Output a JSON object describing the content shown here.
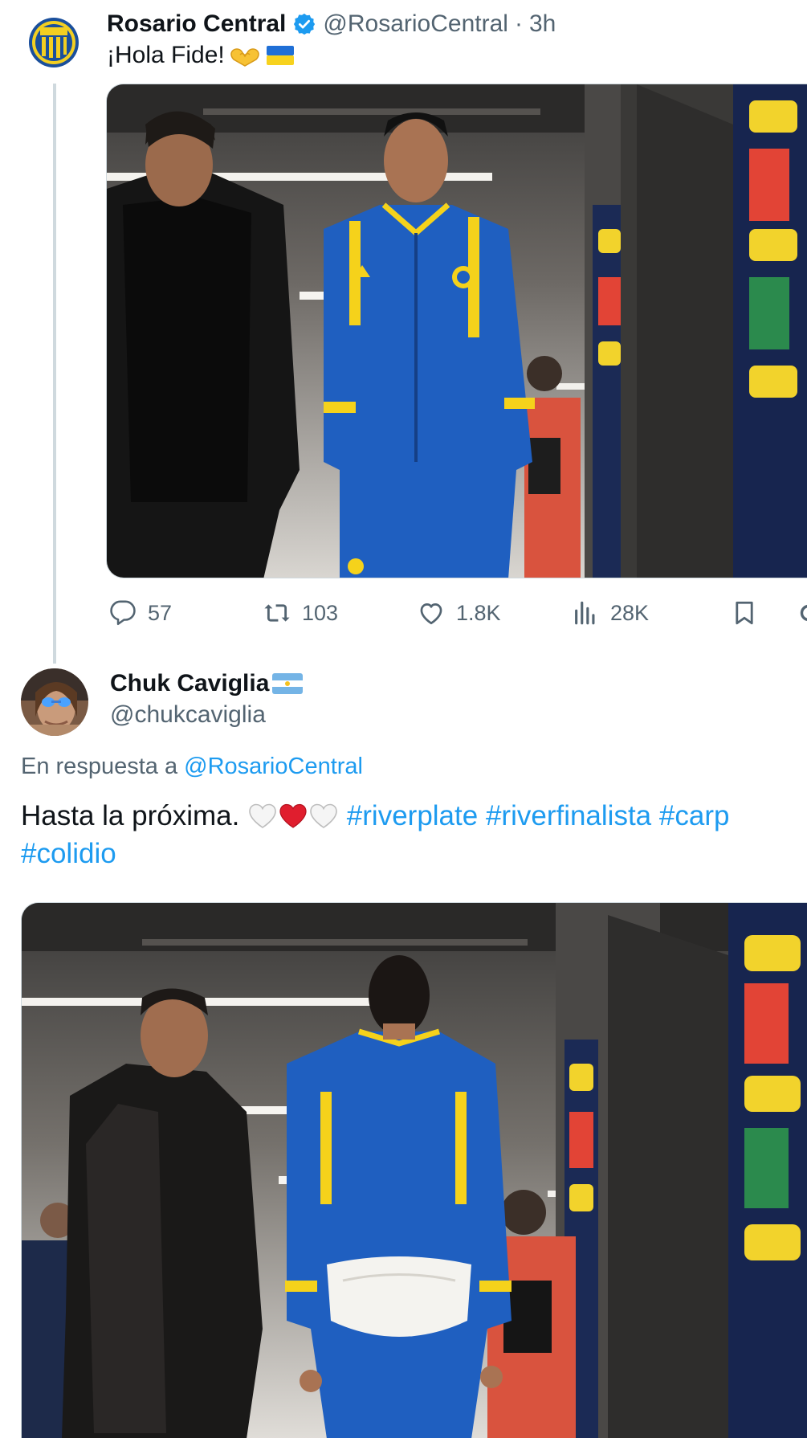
{
  "tweet1": {
    "author_name": "Rosario Central",
    "handle": "@RosarioCentral",
    "separator": "·",
    "time": "3h",
    "text": "¡Hola Fide!",
    "stats": {
      "replies": "57",
      "retweets": "103",
      "likes": "1.8K",
      "views": "28K"
    }
  },
  "tweet2": {
    "author_name": "Chuk Caviglia",
    "handle": "@chukcaviglia",
    "replying_prefix": "En respuesta a",
    "replying_to": "@RosarioCentral",
    "text_start": "Hasta la próxima.",
    "hashtags": [
      "#riverplate",
      "#riverfinalista",
      "#carp",
      "#colidio"
    ]
  },
  "colors": {
    "link": "#1d9bf0",
    "secondary_text": "#536471",
    "primary_text": "#0f1419",
    "jersey_blue": "#1f5fc0",
    "jersey_yellow": "#f5d21b"
  }
}
